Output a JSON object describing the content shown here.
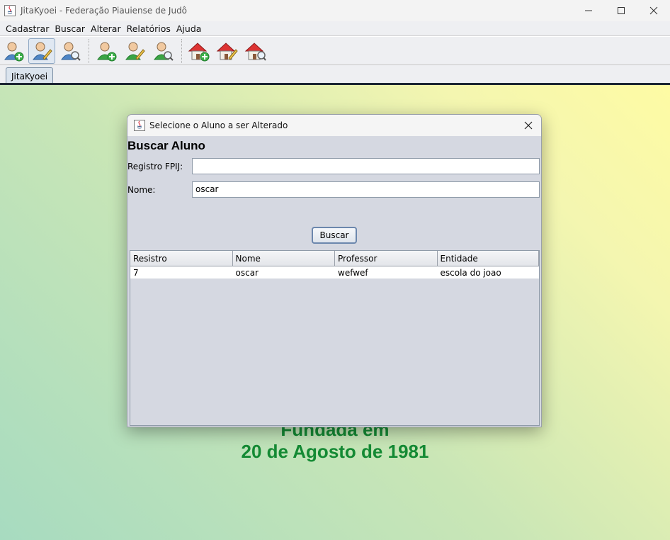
{
  "window": {
    "title": "JitaKyoei - Federação Piauiense de Judô"
  },
  "menu": [
    "Cadastrar",
    "Buscar",
    "Alterar",
    "Relatórios",
    "Ajuda"
  ],
  "toolbar": {
    "groups": [
      [
        "add-user-icon",
        "edit-user-icon",
        "search-user-icon"
      ],
      [
        "add-person-icon",
        "edit-person-icon",
        "search-person-icon"
      ],
      [
        "add-house-icon",
        "edit-house-icon",
        "search-house-icon"
      ]
    ]
  },
  "tab": {
    "label": "JitaKyoei"
  },
  "background": {
    "line1": "Fundada em",
    "line2": "20 de Agosto de 1981"
  },
  "dialog": {
    "title": "Selecione o Aluno a ser Alterado",
    "heading": "Buscar Aluno",
    "registro_label": "Registro FPIJ:",
    "registro_value": "",
    "nome_label": "Nome:",
    "nome_value": "oscar",
    "search_button": "Buscar",
    "table": {
      "columns": [
        "Resistro",
        "Nome",
        "Professor",
        "Entidade"
      ],
      "rows": [
        [
          "7",
          "oscar",
          "wefwef",
          "escola do joao"
        ]
      ]
    }
  },
  "colors": {
    "accent_green": "#148a34",
    "tab_line": "#1c2633"
  }
}
